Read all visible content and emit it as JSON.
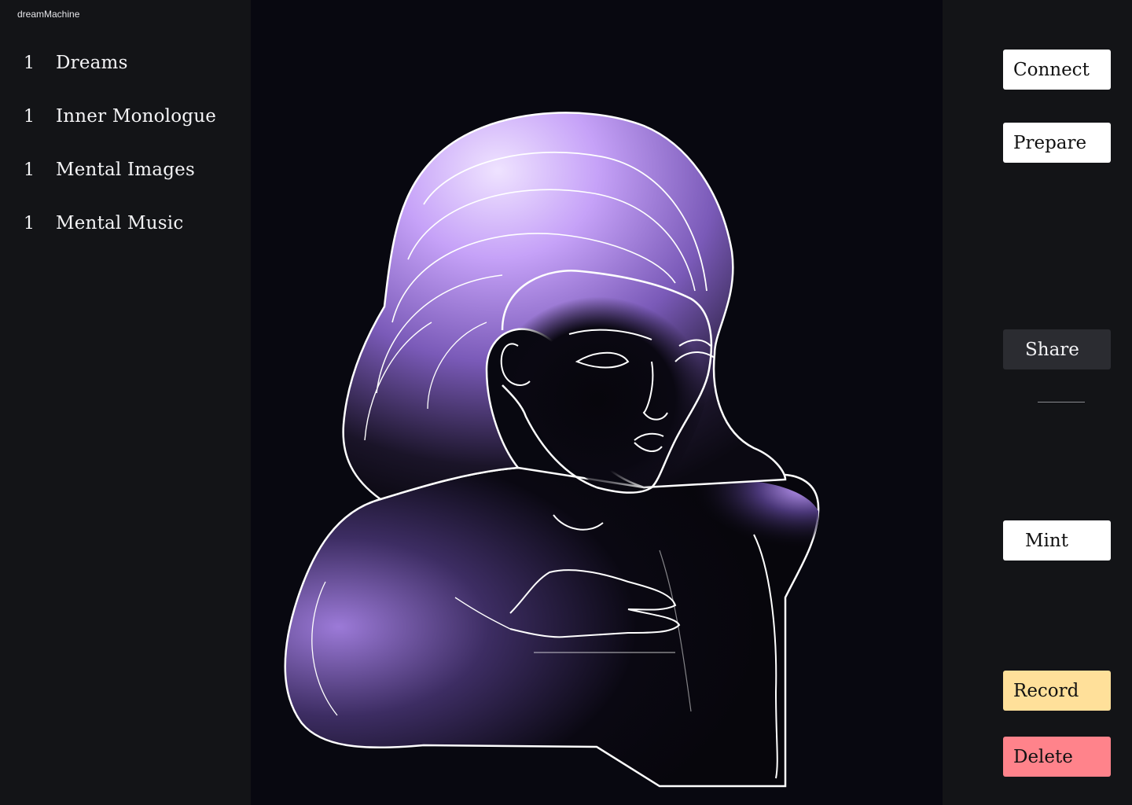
{
  "app": {
    "title": "dreamMachine"
  },
  "sidebar": {
    "items": [
      {
        "count": "1",
        "label": "Dreams"
      },
      {
        "count": "1",
        "label": "Inner Monologue"
      },
      {
        "count": "1",
        "label": "Mental Images"
      },
      {
        "count": "1",
        "label": "Mental Music"
      }
    ]
  },
  "actions": {
    "connect": "Connect",
    "prepare": "Prepare",
    "share": "Share",
    "mint": "Mint",
    "record": "Record",
    "delete": "Delete"
  },
  "colors": {
    "background": "#131417",
    "canvas": "#080810",
    "accent_purple": "#c9a8ff",
    "record": "#ffe09a",
    "delete": "#ff838b",
    "share": "#2b2c31"
  },
  "canvas": {
    "image": "woman-line-art-illustration"
  }
}
